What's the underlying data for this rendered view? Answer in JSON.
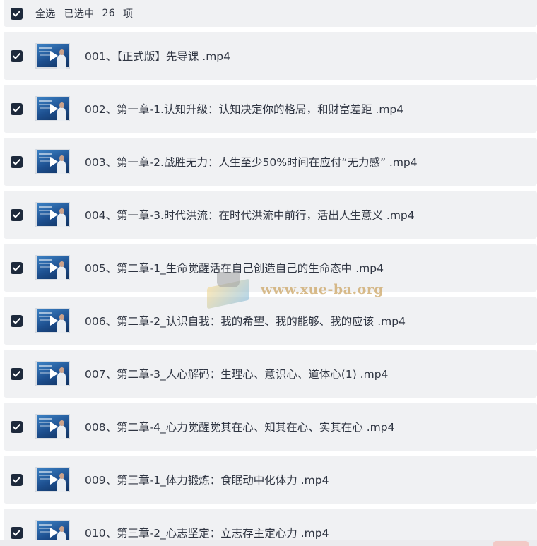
{
  "header": {
    "select_all_label": "全选",
    "selected_text": "已选中",
    "selected_count": "26",
    "unit": "项"
  },
  "items": [
    {
      "title": "001、【正式版】先导课 .mp4",
      "checked": true
    },
    {
      "title": "002、第一章-1.认知升级：认知决定你的格局，和财富差距 .mp4",
      "checked": true
    },
    {
      "title": "003、第一章-2.战胜无力：人生至少50%时间在应付“无力感” .mp4",
      "checked": true
    },
    {
      "title": "004、第一章-3.时代洪流：在时代洪流中前行，活出人生意义 .mp4",
      "checked": true
    },
    {
      "title": "005、第二章-1_生命觉醒活在自己创造自己的生命态中 .mp4",
      "checked": true
    },
    {
      "title": "006、第二章-2_认识自我：我的希望、我的能够、我的应该 .mp4",
      "checked": true
    },
    {
      "title": "007、第二章-3_人心解码：生理心、意识心、道体心(1) .mp4",
      "checked": true
    },
    {
      "title": "008、第二章-4_心力觉醒觉其在心、知其在心、实其在心 .mp4",
      "checked": true
    },
    {
      "title": "009、第三章-1_体力锻炼：食眠动中化体力 .mp4",
      "checked": true
    },
    {
      "title": "010、第三章-2_心志坚定：立志存主定心力 .mp4",
      "checked": true
    }
  ],
  "watermark": {
    "text": "www.xue-ba.org"
  },
  "colors": {
    "row_background": "#f0f1f3",
    "checkbox": "#1e2a3c",
    "text": "#2f3542"
  }
}
